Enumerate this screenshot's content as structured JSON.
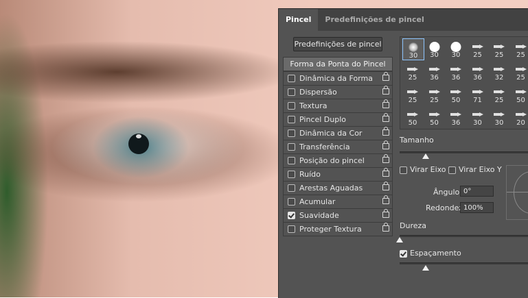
{
  "panel": {
    "tabs": [
      {
        "label": "Pincel",
        "active": true
      },
      {
        "label": "Predefinições de pincel",
        "active": false
      }
    ],
    "presets_button": "Predefinições de pincel",
    "tip_shape": "Forma da Ponta do Pincel",
    "options": [
      {
        "label": "Dinâmica da Forma",
        "checked": false
      },
      {
        "label": "Dispersão",
        "checked": false
      },
      {
        "label": "Textura",
        "checked": false
      },
      {
        "label": "Pincel Duplo",
        "checked": false
      },
      {
        "label": "Dinâmica da Cor",
        "checked": false
      },
      {
        "label": "Transferência",
        "checked": false
      },
      {
        "label": "Posição do pincel",
        "checked": false
      },
      {
        "label": "Ruído",
        "checked": false
      },
      {
        "label": "Arestas Aguadas",
        "checked": false
      },
      {
        "label": "Acumular",
        "checked": false
      },
      {
        "label": "Suavidade",
        "checked": true
      },
      {
        "label": "Proteger Textura",
        "checked": false
      }
    ],
    "brushes": [
      {
        "size": "30",
        "kind": "soft",
        "selected": true
      },
      {
        "size": "30",
        "kind": "hard"
      },
      {
        "size": "30",
        "kind": "hard"
      },
      {
        "size": "25",
        "kind": "tool"
      },
      {
        "size": "25",
        "kind": "tool"
      },
      {
        "size": "25",
        "kind": "tool"
      },
      {
        "size": "25",
        "kind": "tool"
      },
      {
        "size": "36",
        "kind": "tool"
      },
      {
        "size": "36",
        "kind": "tool"
      },
      {
        "size": "36",
        "kind": "tool"
      },
      {
        "size": "32",
        "kind": "tool"
      },
      {
        "size": "25",
        "kind": "tool"
      },
      {
        "size": "25",
        "kind": "tool"
      },
      {
        "size": "25",
        "kind": "tool"
      },
      {
        "size": "50",
        "kind": "tool"
      },
      {
        "size": "71",
        "kind": "tool"
      },
      {
        "size": "25",
        "kind": "tool"
      },
      {
        "size": "50",
        "kind": "tool"
      },
      {
        "size": "50",
        "kind": "tool"
      },
      {
        "size": "50",
        "kind": "tool"
      },
      {
        "size": "36",
        "kind": "tool"
      },
      {
        "size": "30",
        "kind": "tool"
      },
      {
        "size": "30",
        "kind": "tool"
      },
      {
        "size": "20",
        "kind": "tool"
      }
    ],
    "size_label": "Tamanho",
    "size_level": 0.2,
    "flip_x_label": "Virar Eixo X",
    "flip_y_label": "Virar Eixo Y",
    "angle_label": "Ângulo:",
    "angle_value": "0°",
    "roundness_label": "Redondez:",
    "roundness_value": "100%",
    "hardness_label": "Dureza",
    "hardness_level": 0.0,
    "spacing_label": "Espaçamento",
    "spacing_checked": true,
    "spacing_level": 0.2
  }
}
